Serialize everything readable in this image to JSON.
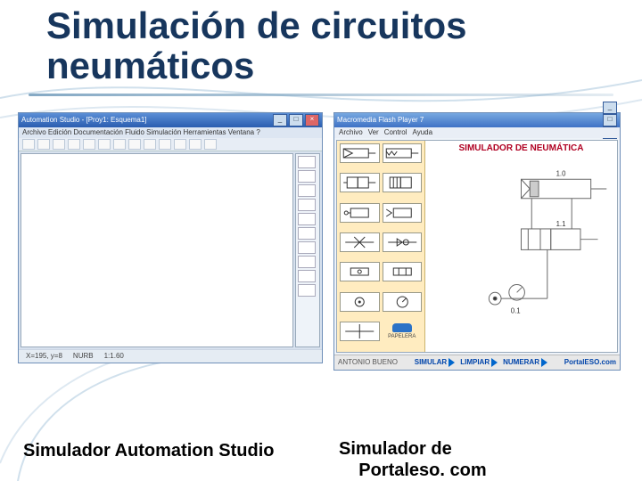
{
  "title_line1": "Simulación de circuitos",
  "title_line2": "neumáticos",
  "caption_left": "Simulador Automation Studio",
  "caption_right_line1": "Simulador de",
  "caption_right_line2": "Portaleso. com",
  "left_app": {
    "title": "Automation Studio - [Proy1: Esquema1]",
    "menu": "Archivo  Edición  Documentación  Fluido  Simulación  Herramientas  Ventana  ?",
    "status": {
      "coords": "X=195, y=8",
      "mode": "NURB",
      "zoom": "1:1.60"
    }
  },
  "right_app": {
    "title": "Macromedia Flash Player 7",
    "menu": [
      "Archivo",
      "Ver",
      "Control",
      "Ayuda"
    ],
    "sim_title": "SIMULADOR DE NEUMÁTICA",
    "trash_label": "PAPELERA",
    "footer_author": "ANTONIO BUENO",
    "footer_simular": "SIMULAR",
    "footer_limpiar": "LIMPIAR",
    "footer_numerar": "NUMERAR",
    "footer_brand": "PortalESO.com",
    "cyl_labels": {
      "top": "1.0",
      "bottom": "1.1",
      "mid": "0.1"
    }
  }
}
